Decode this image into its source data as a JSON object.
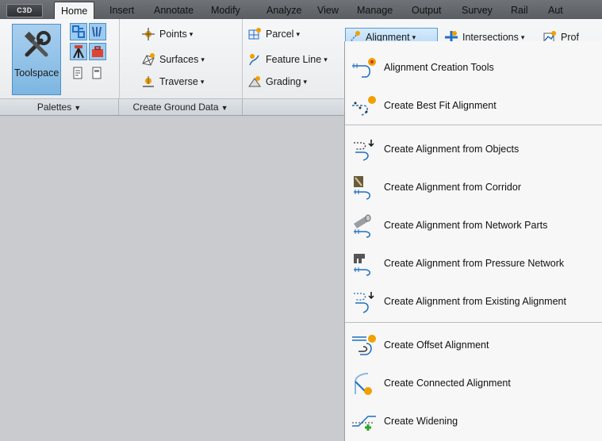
{
  "app": {
    "badge": "C3D"
  },
  "tabs": [
    "Home",
    "Insert",
    "Annotate",
    "Modify",
    "Analyze",
    "View",
    "Manage",
    "Output",
    "Survey",
    "Rail",
    "Aut"
  ],
  "ribbon": {
    "toolspace_label": "Toolspace",
    "panels": {
      "palettes": "Palettes",
      "create_ground_data": "Create Ground Data"
    },
    "buttons": {
      "points": "Points",
      "surfaces": "Surfaces",
      "traverse": "Traverse",
      "parcel": "Parcel",
      "feature_line": "Feature Line",
      "grading": "Grading",
      "alignment": "Alignment",
      "intersections": "Intersections",
      "profile": "Prof"
    }
  },
  "menu": {
    "items": [
      "Alignment Creation Tools",
      "Create Best Fit Alignment",
      "Create Alignment from Objects",
      "Create Alignment from Corridor",
      "Create Alignment from Network Parts",
      "Create Alignment from Pressure Network",
      "Create Alignment from Existing Alignment",
      "Create Offset Alignment",
      "Create Connected Alignment",
      "Create Widening"
    ]
  },
  "colors": {
    "accent": "#5a9bd3",
    "icon_blue": "#1f6fc1",
    "icon_orange": "#f0a000",
    "icon_green": "#2aa52a"
  }
}
